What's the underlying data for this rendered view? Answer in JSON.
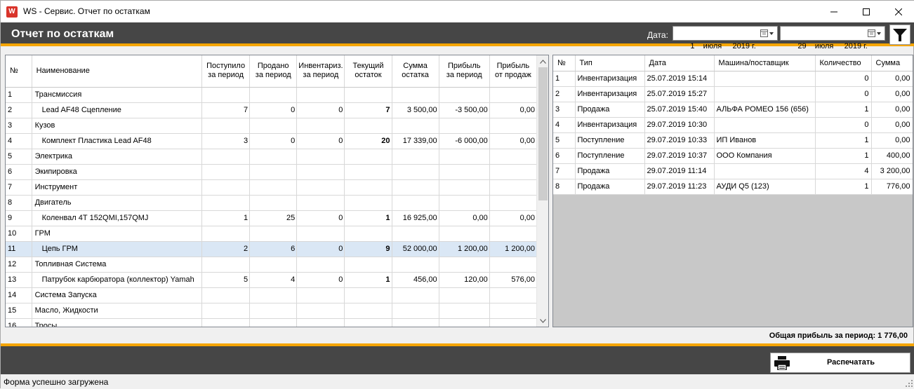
{
  "window": {
    "title": "WS - Сервис. Отчет по остаткам",
    "icon_letter": "W"
  },
  "header": {
    "title": "Отчет по остаткам",
    "date_label": "Дата:",
    "date_from": "1    июля     2019 г.",
    "date_to": "29    июля     2019 г."
  },
  "left_table": {
    "columns": [
      "№",
      "Наименование",
      "Поступило\nза период",
      "Продано\nза период",
      "Инвентариз.\nза период",
      "Текущий\nостаток",
      "Сумма\nостатка",
      "Прибыль\nза период",
      "Прибыль\nот продаж"
    ],
    "rows": [
      {
        "n": "1",
        "name": "Трансмиссия",
        "in": "",
        "sold": "",
        "inv": "",
        "cur": "",
        "sum": "",
        "profit": "",
        "sales_profit": "",
        "sub": false
      },
      {
        "n": "2",
        "name": "Lead AF48 Сцепление",
        "in": "7",
        "sold": "0",
        "inv": "0",
        "cur": "7",
        "sum": "3 500,00",
        "profit": "-3 500,00",
        "sales_profit": "0,00",
        "sub": true
      },
      {
        "n": "3",
        "name": "Кузов",
        "in": "",
        "sold": "",
        "inv": "",
        "cur": "",
        "sum": "",
        "profit": "",
        "sales_profit": "",
        "sub": false
      },
      {
        "n": "4",
        "name": "Комплект Пластика Lead AF48",
        "in": "3",
        "sold": "0",
        "inv": "0",
        "cur": "20",
        "sum": "17 339,00",
        "profit": "-6 000,00",
        "sales_profit": "0,00",
        "sub": true
      },
      {
        "n": "5",
        "name": "Электрика",
        "in": "",
        "sold": "",
        "inv": "",
        "cur": "",
        "sum": "",
        "profit": "",
        "sales_profit": "",
        "sub": false
      },
      {
        "n": "6",
        "name": "Экипировка",
        "in": "",
        "sold": "",
        "inv": "",
        "cur": "",
        "sum": "",
        "profit": "",
        "sales_profit": "",
        "sub": false
      },
      {
        "n": "7",
        "name": "Инструмент",
        "in": "",
        "sold": "",
        "inv": "",
        "cur": "",
        "sum": "",
        "profit": "",
        "sales_profit": "",
        "sub": false
      },
      {
        "n": "8",
        "name": "Двигатель",
        "in": "",
        "sold": "",
        "inv": "",
        "cur": "",
        "sum": "",
        "profit": "",
        "sales_profit": "",
        "sub": false
      },
      {
        "n": "9",
        "name": "Коленвал 4Т 152QMI,157QMJ",
        "in": "1",
        "sold": "25",
        "inv": "0",
        "cur": "1",
        "sum": "16 925,00",
        "profit": "0,00",
        "sales_profit": "0,00",
        "sub": true
      },
      {
        "n": "10",
        "name": "ГРМ",
        "in": "",
        "sold": "",
        "inv": "",
        "cur": "",
        "sum": "",
        "profit": "",
        "sales_profit": "",
        "sub": false
      },
      {
        "n": "11",
        "name": "Цепь ГРМ",
        "in": "2",
        "sold": "6",
        "inv": "0",
        "cur": "9",
        "sum": "52 000,00",
        "profit": "1 200,00",
        "sales_profit": "1 200,00",
        "sub": true,
        "selected": true
      },
      {
        "n": "12",
        "name": "Топливная Система",
        "in": "",
        "sold": "",
        "inv": "",
        "cur": "",
        "sum": "",
        "profit": "",
        "sales_profit": "",
        "sub": false
      },
      {
        "n": "13",
        "name": "Патрубок карбюратора (коллектор)  Yamah",
        "in": "5",
        "sold": "4",
        "inv": "0",
        "cur": "1",
        "sum": "456,00",
        "profit": "120,00",
        "sales_profit": "576,00",
        "sub": true
      },
      {
        "n": "14",
        "name": "Система Запуска",
        "in": "",
        "sold": "",
        "inv": "",
        "cur": "",
        "sum": "",
        "profit": "",
        "sales_profit": "",
        "sub": false
      },
      {
        "n": "15",
        "name": "Масло, Жидкости",
        "in": "",
        "sold": "",
        "inv": "",
        "cur": "",
        "sum": "",
        "profit": "",
        "sales_profit": "",
        "sub": false
      },
      {
        "n": "16",
        "name": "Тросы",
        "in": "",
        "sold": "",
        "inv": "",
        "cur": "",
        "sum": "",
        "profit": "",
        "sales_profit": "",
        "sub": false
      }
    ]
  },
  "right_table": {
    "columns": [
      "№",
      "Тип",
      "Дата",
      "Машина/поставщик",
      "Количество",
      "Сумма"
    ],
    "rows": [
      {
        "n": "1",
        "type": "Инвентаризация",
        "date": "25.07.2019 15:14",
        "party": "",
        "qty": "0",
        "sum": "0,00"
      },
      {
        "n": "2",
        "type": "Инвентаризация",
        "date": "25.07.2019 15:27",
        "party": "",
        "qty": "0",
        "sum": "0,00"
      },
      {
        "n": "3",
        "type": "Продажа",
        "date": "25.07.2019 15:40",
        "party": "АЛЬФА РОМЕО 156 (656)",
        "qty": "1",
        "sum": "0,00"
      },
      {
        "n": "4",
        "type": "Инвентаризация",
        "date": "29.07.2019 10:30",
        "party": "",
        "qty": "0",
        "sum": "0,00"
      },
      {
        "n": "5",
        "type": "Поступление",
        "date": "29.07.2019 10:33",
        "party": "ИП Иванов",
        "qty": "1",
        "sum": "0,00"
      },
      {
        "n": "6",
        "type": "Поступление",
        "date": "29.07.2019 10:37",
        "party": "ООО Компания",
        "qty": "1",
        "sum": "400,00"
      },
      {
        "n": "7",
        "type": "Продажа",
        "date": "29.07.2019 11:14",
        "party": "",
        "qty": "4",
        "sum": "3 200,00"
      },
      {
        "n": "8",
        "type": "Продажа",
        "date": "29.07.2019 11:23",
        "party": "АУДИ Q5 (123)",
        "qty": "1",
        "sum": "776,00"
      }
    ]
  },
  "total": {
    "text": "Общая прибыль за период:  1 776,00"
  },
  "footer": {
    "print_label": "Распечатать"
  },
  "status": {
    "text": "Форма успешно загружена"
  },
  "colors": {
    "header_bg": "#464646",
    "accent": "#f5a500",
    "selected_row": "#dae7f5"
  }
}
